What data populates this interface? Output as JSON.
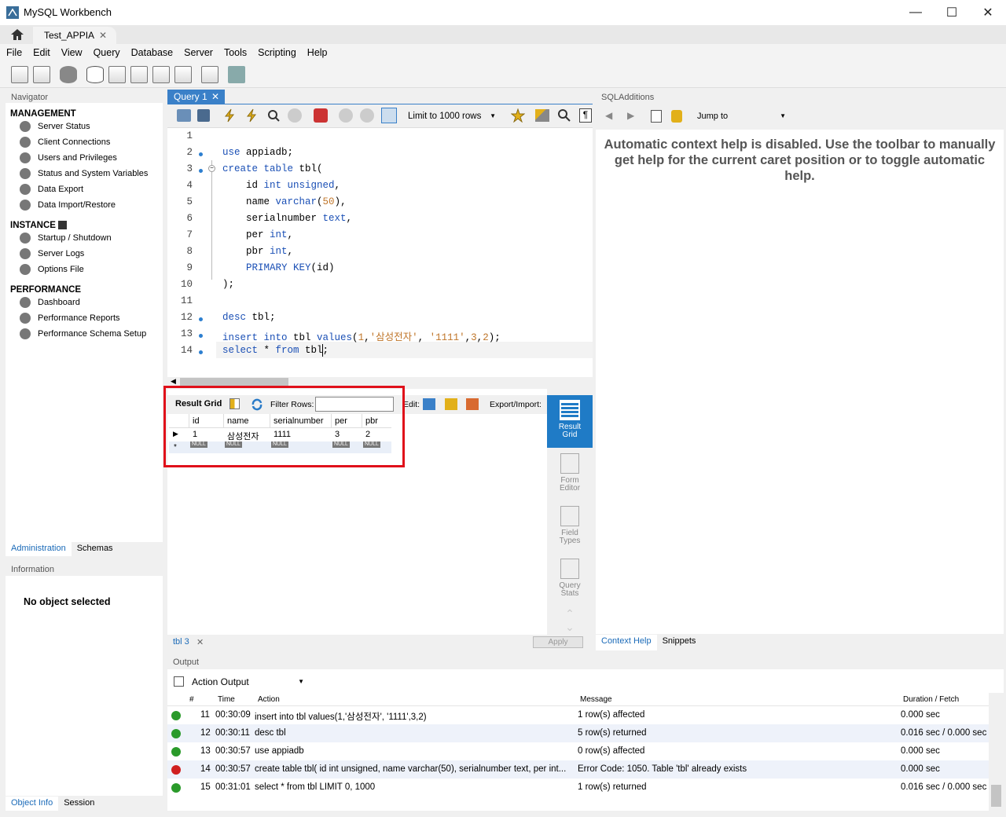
{
  "window": {
    "title": "MySQL Workbench"
  },
  "tabs": {
    "connection": "Test_APPIA"
  },
  "menu": [
    "File",
    "Edit",
    "View",
    "Query",
    "Database",
    "Server",
    "Tools",
    "Scripting",
    "Help"
  ],
  "navigator": {
    "header": "Navigator",
    "management_title": "MANAGEMENT",
    "management": [
      "Server Status",
      "Client Connections",
      "Users and Privileges",
      "Status and System Variables",
      "Data Export",
      "Data Import/Restore"
    ],
    "instance_title": "INSTANCE",
    "instance": [
      "Startup / Shutdown",
      "Server Logs",
      "Options File"
    ],
    "performance_title": "PERFORMANCE",
    "performance": [
      "Dashboard",
      "Performance Reports",
      "Performance Schema Setup"
    ],
    "tab_admin": "Administration",
    "tab_schemas": "Schemas"
  },
  "information": {
    "header": "Information",
    "empty": "No object selected",
    "tab_objinfo": "Object Info",
    "tab_session": "Session"
  },
  "query_tab": {
    "label": "Query 1",
    "limit": "Limit to 1000 rows"
  },
  "editor": {
    "lines": [
      {
        "n": "1",
        "dot": false
      },
      {
        "n": "2",
        "dot": true
      },
      {
        "n": "3",
        "dot": true
      },
      {
        "n": "4",
        "dot": false
      },
      {
        "n": "5",
        "dot": false
      },
      {
        "n": "6",
        "dot": false
      },
      {
        "n": "7",
        "dot": false
      },
      {
        "n": "8",
        "dot": false
      },
      {
        "n": "9",
        "dot": false
      },
      {
        "n": "10",
        "dot": false
      },
      {
        "n": "11",
        "dot": false
      },
      {
        "n": "12",
        "dot": true
      },
      {
        "n": "13",
        "dot": true
      },
      {
        "n": "14",
        "dot": true
      }
    ]
  },
  "result": {
    "result_grid": "Result Grid",
    "filter_label": "Filter Rows:",
    "edit_label": "Edit:",
    "export_label": "Export/Import:",
    "columns": [
      "id",
      "name",
      "serialnumber",
      "per",
      "pbr"
    ],
    "row": [
      "1",
      "삼성전자",
      "1111",
      "3",
      "2"
    ],
    "null": "NULL",
    "tab": "tbl 3",
    "apply": "Apply"
  },
  "sidepanel": {
    "result_grid": "Result Grid",
    "form_editor": "Form Editor",
    "field_types": "Field Types",
    "query_stats": "Query Stats"
  },
  "sqladditions": {
    "header": "SQLAdditions",
    "jump": "Jump to",
    "help": "Automatic context help is disabled. Use the toolbar to manually get help for the current caret position or to toggle automatic help.",
    "tab_context": "Context Help",
    "tab_snippets": "Snippets"
  },
  "output": {
    "header": "Output",
    "select": "Action Output",
    "cols": {
      "num": "#",
      "time": "Time",
      "action": "Action",
      "message": "Message",
      "duration": "Duration / Fetch"
    },
    "rows": [
      {
        "status": "ok",
        "num": "11",
        "time": "00:30:09",
        "action": "insert into tbl values(1,'삼성전자', '1111',3,2)",
        "message": "1 row(s) affected",
        "duration": "0.000 sec"
      },
      {
        "status": "ok",
        "num": "12",
        "time": "00:30:11",
        "action": "desc tbl",
        "message": "5 row(s) returned",
        "duration": "0.016 sec / 0.000 sec"
      },
      {
        "status": "ok",
        "num": "13",
        "time": "00:30:57",
        "action": "use appiadb",
        "message": "0 row(s) affected",
        "duration": "0.000 sec"
      },
      {
        "status": "err",
        "num": "14",
        "time": "00:30:57",
        "action": "create table tbl( id int unsigned,     name varchar(50),     serialnumber text,     per int...",
        "message": "Error Code: 1050. Table 'tbl' already exists",
        "duration": "0.000 sec"
      },
      {
        "status": "ok",
        "num": "15",
        "time": "00:31:01",
        "action": "select * from tbl LIMIT 0, 1000",
        "message": "1 row(s) returned",
        "duration": "0.016 sec / 0.000 sec"
      }
    ]
  }
}
